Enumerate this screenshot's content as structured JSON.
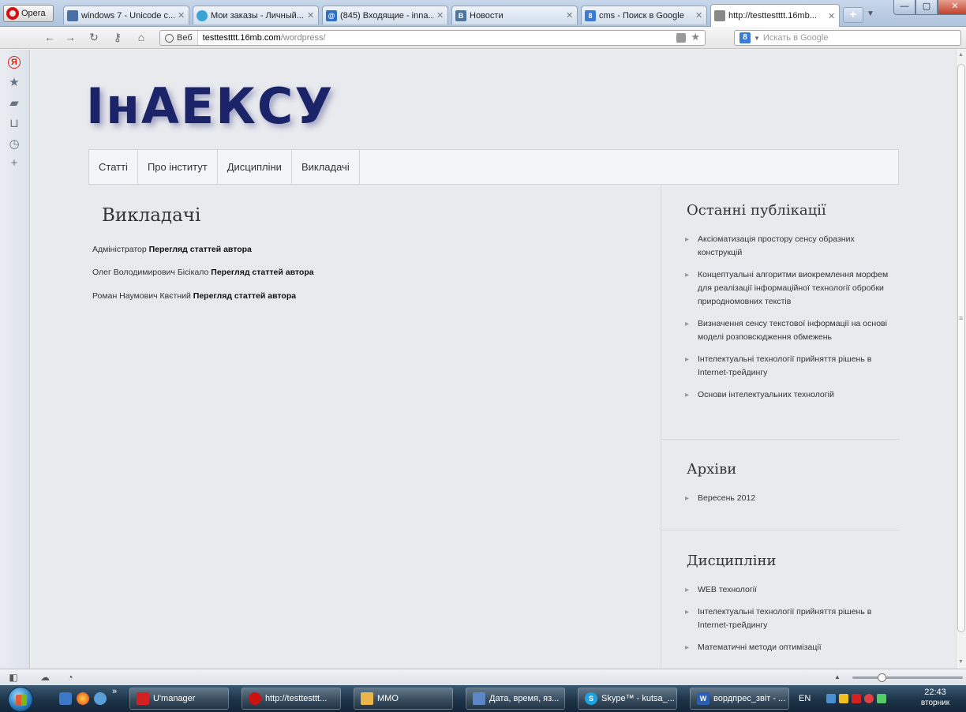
{
  "browser": {
    "menu_label": "Opera",
    "tabs": [
      {
        "title": "windows 7 - Unicode c...",
        "favicon": "document-icon",
        "color": "#4a6fa5"
      },
      {
        "title": "Мои заказы - Личный...",
        "favicon": "globe-icon",
        "color": "#3aa3d6"
      },
      {
        "title": "(845) Входящие - inna...",
        "favicon": "mail-icon",
        "color": "#2f6fbf"
      },
      {
        "title": "Новости",
        "favicon": "vk-icon",
        "color": "#4c75a3"
      },
      {
        "title": "cms - Поиск в Google",
        "favicon": "google-icon",
        "color": "#3a7bd5"
      },
      {
        "title": "http://testtestttt.16mb...",
        "favicon": "page-icon",
        "color": "#888888"
      }
    ],
    "address": {
      "site_badge": "Веб",
      "url_domain": "testtestttt.16mb.com",
      "url_path": "/wordpress/"
    },
    "search": {
      "placeholder": "Искать в Google"
    }
  },
  "site": {
    "logo": "ІнАЕКСУ",
    "menu": [
      "Статті",
      "Про інститут",
      "Дисципліни",
      "Викладачі"
    ],
    "page_title": "Викладачі",
    "authors": [
      {
        "name": "Адміністратор",
        "link": "Перегляд статтей автора"
      },
      {
        "name": "Олег Володимирович Бісікало",
        "link": "Перегляд статтей автора"
      },
      {
        "name": "Роман Наумович Квєтний",
        "link": "Перегляд статтей автора"
      }
    ],
    "sidebar": {
      "recent": {
        "title": "Останні публікації",
        "items": [
          "Аксіоматизація простору сенсу образних конструкцій",
          "Концептуальні алгоритми виокремлення морфем для реалізації інформаційної технології обробки природномовних текстів",
          "Визначення сенсу текстової інформації на основі моделі розповсюдження обмежень",
          "Інтелектуальні технології прийняття рішень в Internet-трейдингу",
          "Основи інтелектуальних технологій"
        ]
      },
      "archives": {
        "title": "Архіви",
        "items": [
          "Вересень 2012"
        ]
      },
      "disciplines": {
        "title": "Дисципліни",
        "items": [
          "WEB технології",
          "Інтелектуальні технології прийняття рішень в Internet-трейдингу",
          "Математичні методи оптимізації"
        ]
      }
    }
  },
  "taskbar": {
    "buttons": [
      {
        "label": "U'manager",
        "icon": "umanager-icon",
        "color": "#d32020"
      },
      {
        "label": "http://testtesttt...",
        "icon": "opera-icon",
        "color": "#cc1111"
      },
      {
        "label": "ММО",
        "icon": "folder-icon",
        "color": "#e8b64a"
      },
      {
        "label": "Дата, время, яз...",
        "icon": "settings-icon",
        "color": "#5b87c4"
      },
      {
        "label": "Skype™ - kutsa_...",
        "icon": "skype-icon",
        "color": "#1fa0e0"
      },
      {
        "label": "вордпрес_звіт - ...",
        "icon": "word-icon",
        "color": "#2b5fb0"
      }
    ],
    "language": "EN",
    "time": "22:43",
    "day": "вторник"
  }
}
